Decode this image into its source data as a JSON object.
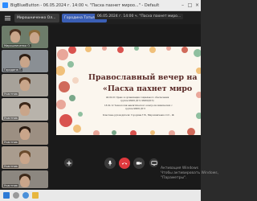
{
  "window": {
    "title": "BigBlueButton - 06.05.2024 г. 14:00 ч. \"Пасха пахнет мироо...\" - Default"
  },
  "toolbar": {
    "tabs": [
      {
        "label": "Мирошниченко Ол..."
      },
      {
        "label": "Городина Татьяна..."
      }
    ]
  },
  "stage": {
    "label": "06.05.2024 г. 14:00 ч. \"Пасха пахнет миро..."
  },
  "participants": [
    {
      "name": "Мирошниченко О."
    },
    {
      "name": "Городина Т."
    },
    {
      "name": "Участник"
    },
    {
      "name": "Участник"
    },
    {
      "name": "Участник"
    },
    {
      "name": "Участник"
    },
    {
      "name": "Участник"
    }
  ],
  "slide": {
    "title_line1": "Православный вечер на",
    "title_line2": "«Пасха пахнет миро",
    "line1": "40.02.01 Право и организация социального обеспечения",
    "line2": "группа 96061ДТЛ, 96060ДТЛ)",
    "line3": "18.02.12 Технология аналитического контроля химических с",
    "line4": "группа 98061ДТЛ",
    "line5": "Классные руководители: Городина Т.В., Мирошниченко О.С., Ж",
    "colors": {
      "title": "#5a2b28",
      "background": "#fbf6ee"
    }
  },
  "watermark": {
    "line1": "Активация Windows",
    "line2": "Чтобы активировать Windows,",
    "line3": "\"Параметры\"."
  },
  "icons": {
    "mic": "microphone-icon",
    "camera": "camera-icon",
    "screen": "screen-share-icon",
    "leave": "phone-hangup-icon"
  },
  "colors": {
    "accent": "#3b5fb5",
    "danger": "#e0393e",
    "chrome": "#1f1f1f"
  }
}
